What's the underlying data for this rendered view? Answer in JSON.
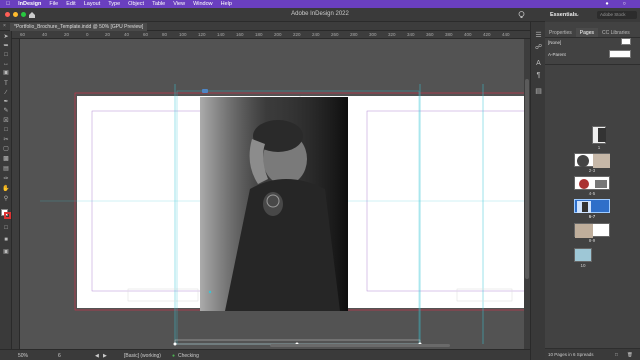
{
  "menubar": {
    "app": "InDesign",
    "items": [
      "File",
      "Edit",
      "Layout",
      "Type",
      "Object",
      "Table",
      "View",
      "Window",
      "Help"
    ]
  },
  "window_title": "Adobe InDesign 2022",
  "doc_tab": "*Portfolio_Brochure_Template.indd @ 50% [GPU Preview]",
  "ruler_h": [
    "60",
    "40",
    "20",
    "0",
    "20",
    "40",
    "60",
    "80",
    "100",
    "120",
    "140",
    "160",
    "180",
    "200",
    "220",
    "240",
    "260",
    "280",
    "300",
    "320",
    "340",
    "360",
    "380",
    "400",
    "420",
    "440"
  ],
  "workspace": {
    "label": "Essentials",
    "search_placeholder": "Adobe Stock"
  },
  "panel": {
    "tabs": [
      "Properties",
      "Pages",
      "CC Libraries"
    ],
    "active_tab": "Pages",
    "masters": [
      "[None]",
      "A-Parent"
    ],
    "pages": [
      {
        "label": "1"
      },
      {
        "label": "2-3"
      },
      {
        "label": "4-5"
      },
      {
        "label": "6-7"
      },
      {
        "label": "8-9"
      },
      {
        "label": "10"
      }
    ],
    "footer": "10 Pages in 6 Spreads"
  },
  "status": {
    "zoom": "50%",
    "page": "6",
    "style": "[Basic] (working)",
    "preflight": "Checking"
  },
  "colors": {
    "accent": "#6a3fbf",
    "guide": "#39c6d6",
    "bleed": "#d9314a"
  }
}
